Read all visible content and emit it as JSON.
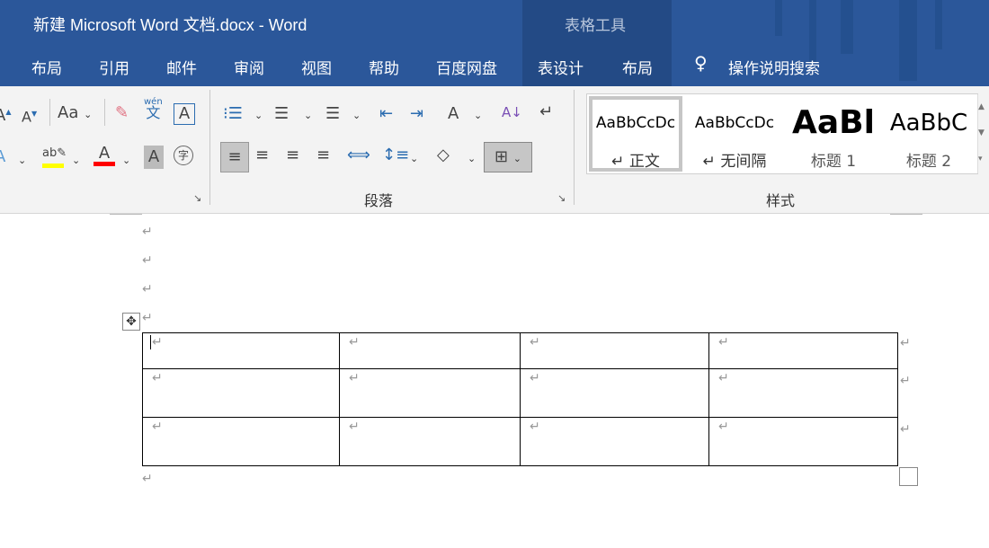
{
  "title": "新建 Microsoft Word 文档.docx  -  Word",
  "context_tab_group": "表格工具",
  "tabs": [
    "布局",
    "引用",
    "邮件",
    "审阅",
    "视图",
    "帮助",
    "百度网盘",
    "表设计",
    "布局"
  ],
  "tell_me": "操作说明搜索",
  "ribbon": {
    "font_icons": [
      "grow-font",
      "shrink-font",
      "change-case",
      "clear-formatting",
      "phonetic-guide",
      "character-border",
      "text-effects",
      "highlight",
      "font-color",
      "character-shading",
      "enclosed-character"
    ],
    "change_case_label": "Aa",
    "phonetic_label": "wén",
    "enclose_label": "字",
    "highlight_color": "#ffff00",
    "font_color": "#ff0000",
    "paragraph_group": "段落",
    "styles_group": "样式",
    "styles": [
      {
        "preview": "AaBbCcDc",
        "name": "正文",
        "selected": true
      },
      {
        "preview": "AaBbCcDc",
        "name": "无间隔"
      },
      {
        "preview": "AaBl",
        "name": "标题 1"
      },
      {
        "preview": "AaBbC",
        "name": "标题 2"
      }
    ]
  },
  "document": {
    "paragraph_mark": "↵",
    "table": {
      "rows": 3,
      "cols": 4
    }
  },
  "colors": {
    "brand": "#2b579a",
    "context": "#234a85"
  }
}
